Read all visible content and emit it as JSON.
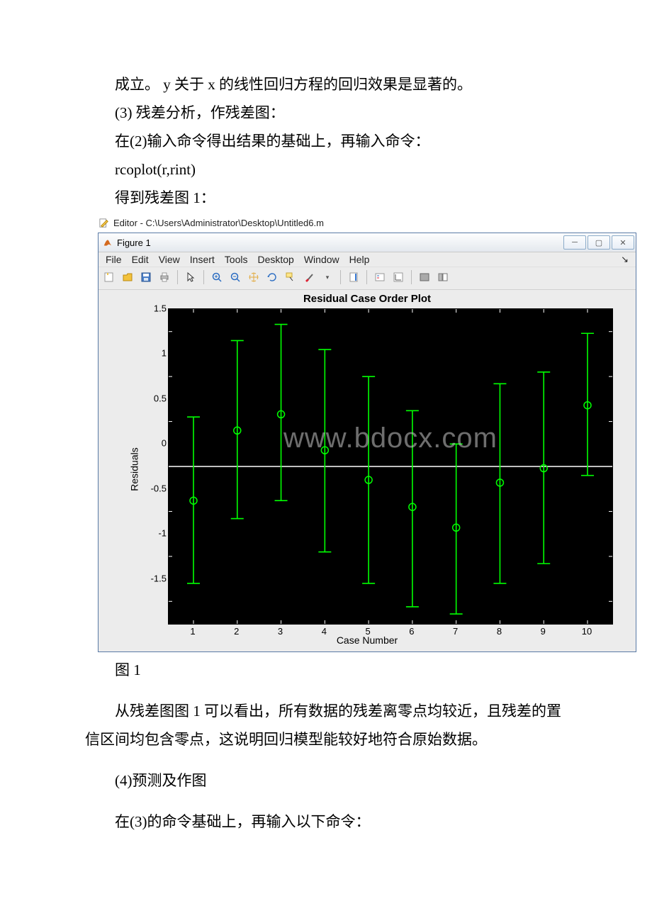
{
  "paragraphs": {
    "p1": "成立。 y 关于 x 的线性回归方程的回归效果是显著的。",
    "p2": "(3) 残差分析，作残差图：",
    "p3": "在(2)输入命令得出结果的基础上，再输入命令：",
    "p4": "rcoplot(r,rint)",
    "p5": "得到残差图 1：",
    "caption": "图 1",
    "p6": "从残差图图 1 可以看出，所有数据的残差离零点均较近，且残差的置信区间均包含零点，这说明回归模型能较好地符合原始数据。",
    "p7": "(4)预测及作图",
    "p8": "在(3)的命令基础上，再输入以下命令："
  },
  "editor": {
    "title": "Editor - C:\\Users\\Administrator\\Desktop\\Untitled6.m"
  },
  "figureWindow": {
    "title": "Figure 1",
    "menus": [
      "File",
      "Edit",
      "View",
      "Insert",
      "Tools",
      "Desktop",
      "Window",
      "Help"
    ]
  },
  "watermark": "www.bdocx.com",
  "chart_data": {
    "type": "errorbar",
    "title": "Residual Case Order Plot",
    "xlabel": "Case Number",
    "ylabel": "Residuals",
    "ylim": [
      -1.75,
      1.75
    ],
    "yticks": [
      -1.5,
      -1,
      -0.5,
      0,
      0.5,
      1,
      1.5
    ],
    "xticks": [
      1,
      2,
      3,
      4,
      5,
      6,
      7,
      8,
      9,
      10
    ],
    "series": [
      {
        "name": "residuals",
        "color": "#00ff00",
        "points": [
          {
            "x": 1,
            "y": -0.38,
            "low": -1.3,
            "high": 0.55
          },
          {
            "x": 2,
            "y": 0.4,
            "low": -0.58,
            "high": 1.4
          },
          {
            "x": 3,
            "y": 0.58,
            "low": -0.38,
            "high": 1.58
          },
          {
            "x": 4,
            "y": 0.18,
            "low": -0.95,
            "high": 1.3
          },
          {
            "x": 5,
            "y": -0.15,
            "low": -1.3,
            "high": 1.0
          },
          {
            "x": 6,
            "y": -0.45,
            "low": -1.56,
            "high": 0.62
          },
          {
            "x": 7,
            "y": -0.68,
            "low": -1.64,
            "high": 0.25
          },
          {
            "x": 8,
            "y": -0.18,
            "low": -1.3,
            "high": 0.92
          },
          {
            "x": 9,
            "y": -0.02,
            "low": -1.08,
            "high": 1.05
          },
          {
            "x": 10,
            "y": 0.68,
            "low": -0.1,
            "high": 1.48
          }
        ]
      }
    ]
  }
}
